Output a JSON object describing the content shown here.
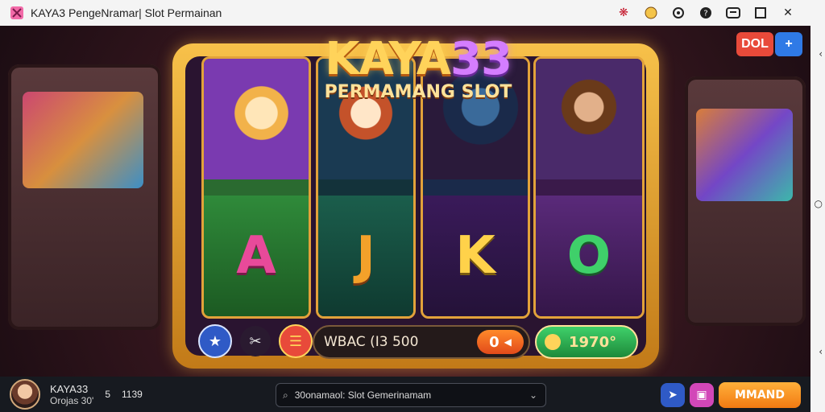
{
  "window": {
    "title": "KAYA3 PengeNramar| Slot Permainan"
  },
  "logo": {
    "main_left": "KAYA",
    "main_right": "33",
    "sub": "PERMAMANG SLOT"
  },
  "top_right": {
    "left_btn": "DOL",
    "right_btn": "+"
  },
  "reels": [
    {
      "symbol": "A",
      "color": "#e84a9a"
    },
    {
      "symbol": "J",
      "color": "#f3a12a"
    },
    {
      "symbol": "K",
      "color": "#ffd24a"
    },
    {
      "symbol": "O",
      "color": "#3fd06a"
    }
  ],
  "controls": {
    "bet_label": "WBAC (I3 500",
    "bet_value": "0",
    "win_value": "1970°"
  },
  "bottom": {
    "user_name": "KAYA33",
    "user_sub": "Orojas 30'",
    "stat_a": "5",
    "stat_b": "1139",
    "search_value": "30onamaol: Slot Gemerinamam",
    "cta_label": "MMAND"
  },
  "colors": {
    "frame_gold": "#f2b43a",
    "bottom_bar": "#171a20",
    "cta_orange": "#f27a12",
    "accent_blue": "#2f7ae6",
    "accent_red": "#e84a3a",
    "accent_green": "#3fd06a"
  },
  "icons": {
    "app": "game-cube-icon",
    "search": "search-icon",
    "close": "close-icon"
  }
}
